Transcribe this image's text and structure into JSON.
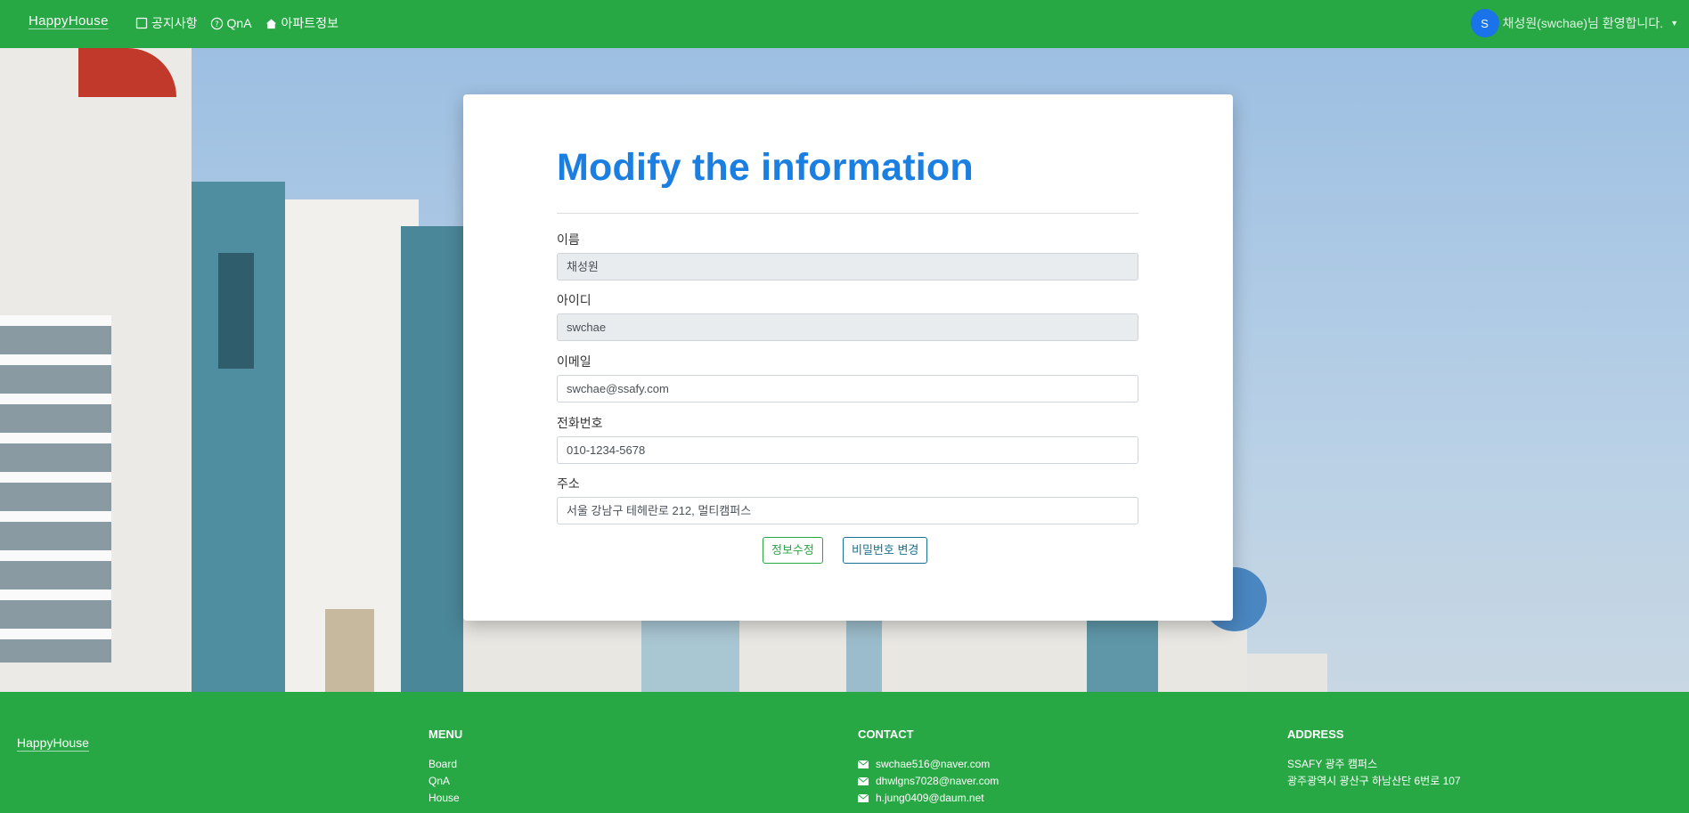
{
  "navbar": {
    "brand": "HappyHouse",
    "items": [
      {
        "label": "공지사항",
        "icon": "notice-square-icon"
      },
      {
        "label": "QnA",
        "icon": "question-circle-icon"
      },
      {
        "label": "아파트정보",
        "icon": "house-icon"
      }
    ],
    "user": {
      "avatar_initial": "S",
      "welcome": "채성원(swchae)님 환영합니다."
    }
  },
  "form": {
    "title": "Modify the information",
    "fields": [
      {
        "label": "이름",
        "value": "채성원",
        "readonly": true
      },
      {
        "label": "아이디",
        "value": "swchae",
        "readonly": true
      },
      {
        "label": "이메일",
        "value": "swchae@ssafy.com",
        "readonly": false
      },
      {
        "label": "전화번호",
        "value": "010-1234-5678",
        "readonly": false
      },
      {
        "label": "주소",
        "value": "서울 강남구 테헤란로 212, 멀티캠퍼스",
        "readonly": false
      }
    ],
    "buttons": {
      "modify": "정보수정",
      "change_password": "비밀번호 변경"
    }
  },
  "footer": {
    "brand": "HappyHouse",
    "menu": {
      "heading": "MENU",
      "items": [
        "Board",
        "QnA",
        "House"
      ]
    },
    "contact": {
      "heading": "CONTACT",
      "emails": [
        "swchae516@naver.com",
        "dhwlgns7028@naver.com",
        "h.jung0409@daum.net"
      ]
    },
    "address": {
      "heading": "ADDRESS",
      "lines": [
        "SSAFY 광주 캠퍼스",
        "광주광역시 광산구 하남산단 6번로 107"
      ]
    }
  },
  "colors": {
    "primary_green": "#28a745",
    "title_blue": "#1a7fe0",
    "avatar_blue": "#1a73e8"
  }
}
